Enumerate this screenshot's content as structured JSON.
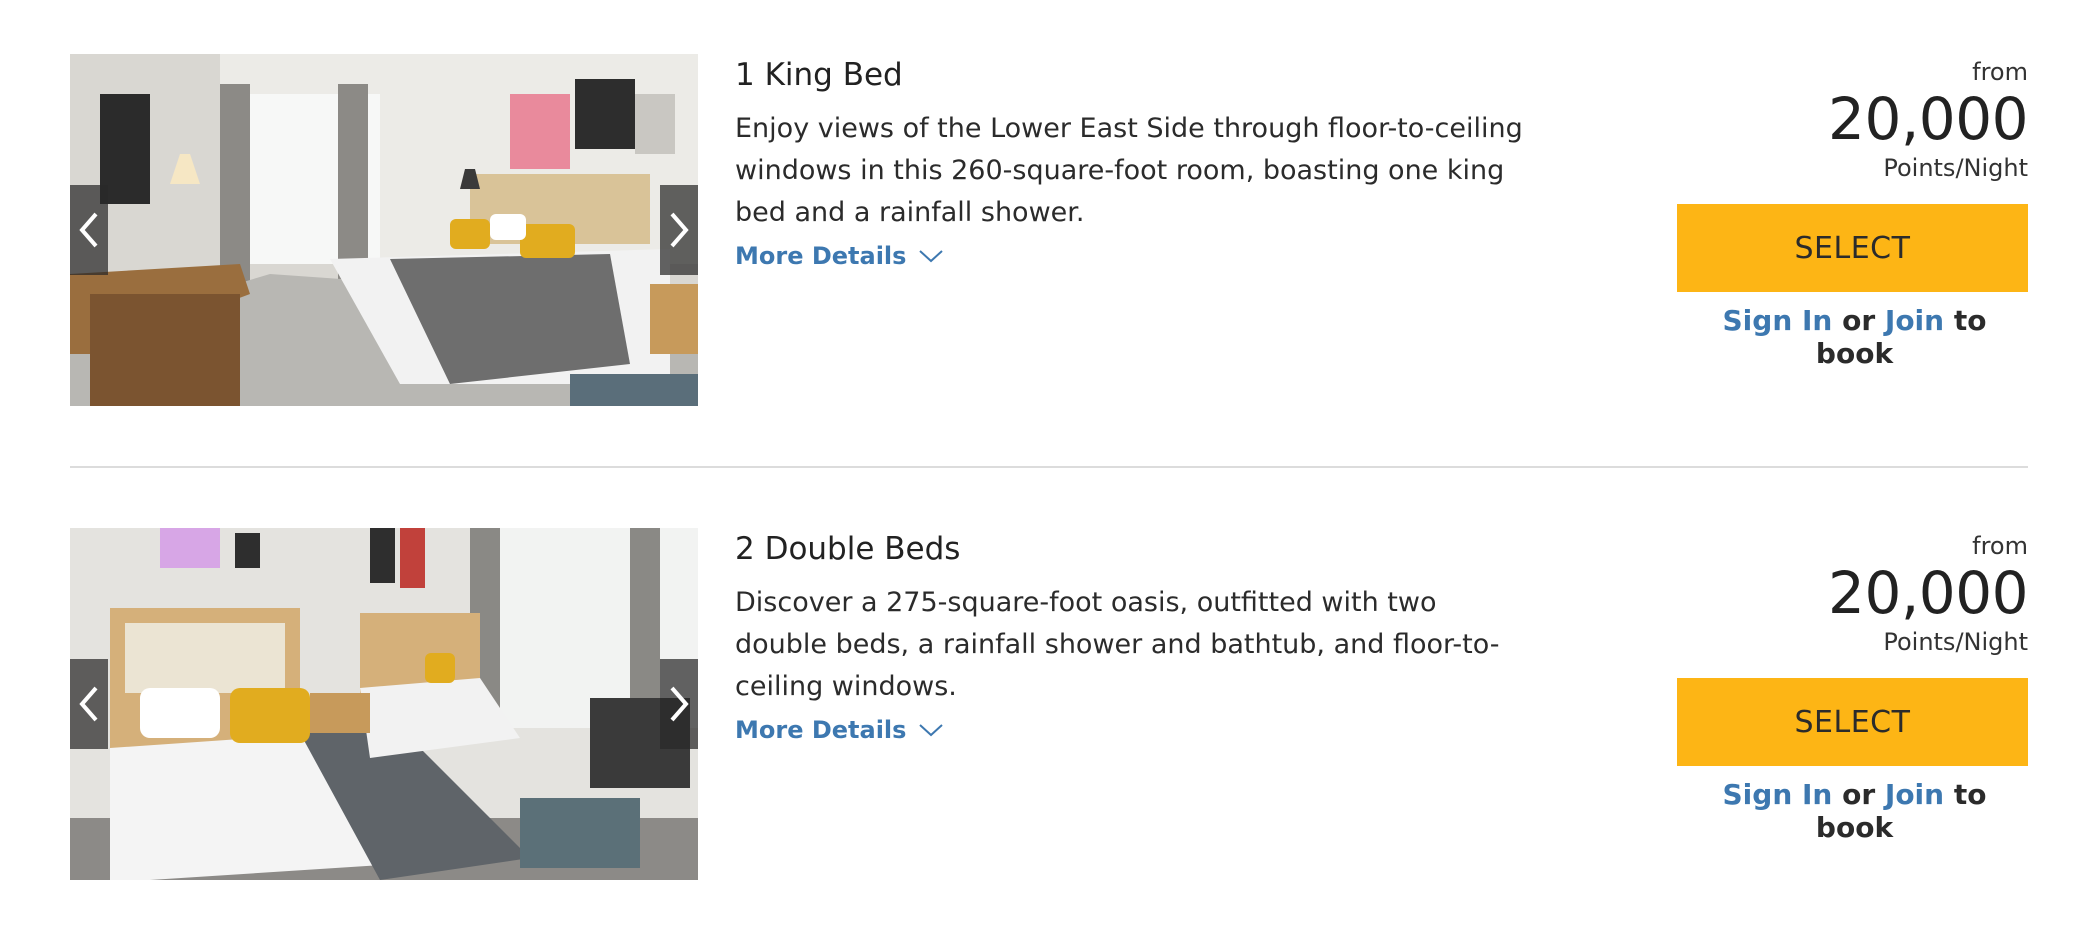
{
  "rooms": [
    {
      "title": "1 King Bed",
      "description": "Enjoy views of the Lower East Side through floor-to-ceiling windows in this 260-square-foot room, boasting one king bed and a rainfall shower.",
      "more_details": "More Details",
      "price_prefix": "from",
      "price": "20,000",
      "price_unit": "Points/Night",
      "select_label": "SELECT",
      "sign_in": "Sign In",
      "or": "or",
      "join": "Join",
      "to_book": "to book"
    },
    {
      "title": "2 Double Beds",
      "description": "Discover a 275-square-foot oasis, outfitted with two double beds, a rainfall shower and bathtub, and floor-to-ceiling windows.",
      "more_details": "More Details",
      "price_prefix": "from",
      "price": "20,000",
      "price_unit": "Points/Night",
      "select_label": "SELECT",
      "sign_in": "Sign In",
      "or": "or",
      "join": "Join",
      "to_book": "to book"
    }
  ],
  "colors": {
    "accent_button": "#fdb515",
    "link": "#3d78b0",
    "text": "#2b2b2b",
    "divider": "#dcdcdc"
  },
  "icons": {
    "prev": "chevron-left-icon",
    "next": "chevron-right-icon",
    "expand": "chevron-down-icon"
  }
}
